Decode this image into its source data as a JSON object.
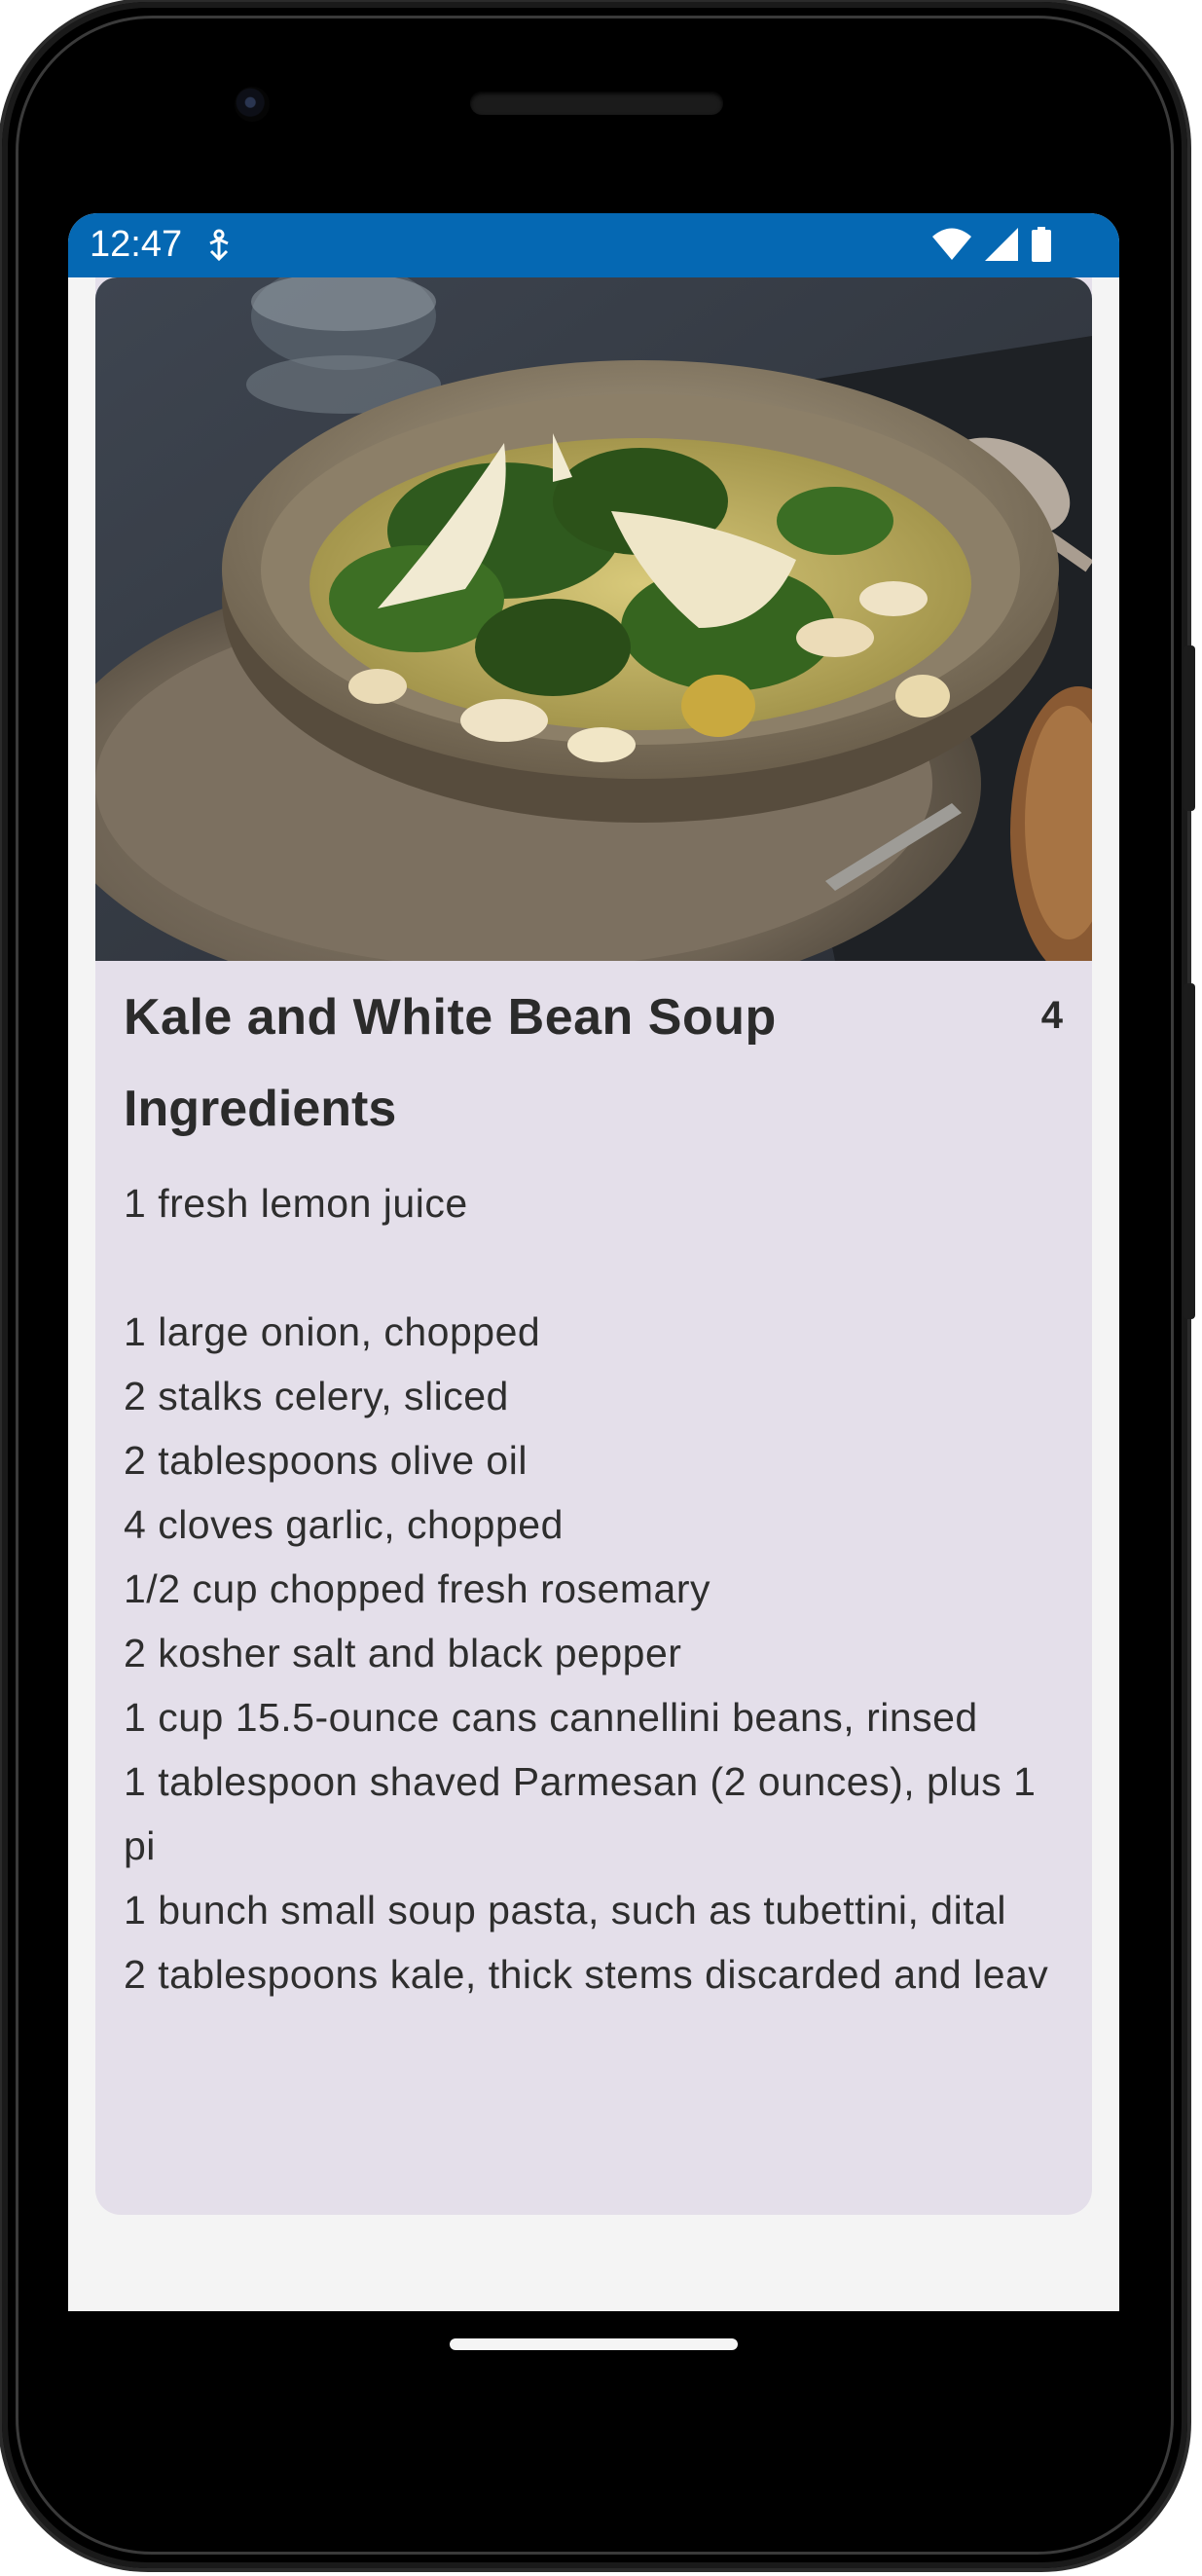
{
  "status_bar": {
    "time": "12:47",
    "notification_icon": "accessibility-download-icon",
    "icons": [
      "wifi-icon",
      "signal-icon",
      "battery-icon"
    ],
    "color": "#0568b3"
  },
  "recipe": {
    "image_alt": "kale-white-bean-soup-photo",
    "title": "Kale and White Bean Soup",
    "servings": "4",
    "section_label": "Ingredients",
    "ingredients": [
      "1 fresh lemon juice",
      "",
      "1 large onion, chopped",
      "2 stalks celery, sliced",
      "2 tablespoons olive oil",
      "4 cloves garlic, chopped",
      "1/2 cup chopped fresh rosemary",
      "2 kosher salt and black pepper",
      "1 cup 15.5-ounce cans cannellini beans, rinsed",
      "1 tablespoon shaved Parmesan (2 ounces), plus 1 pi",
      "1 bunch small soup pasta, such as tubettini, dital",
      "2 tablespoons kale, thick stems discarded and leav"
    ],
    "card_color": "#e4dfea"
  }
}
